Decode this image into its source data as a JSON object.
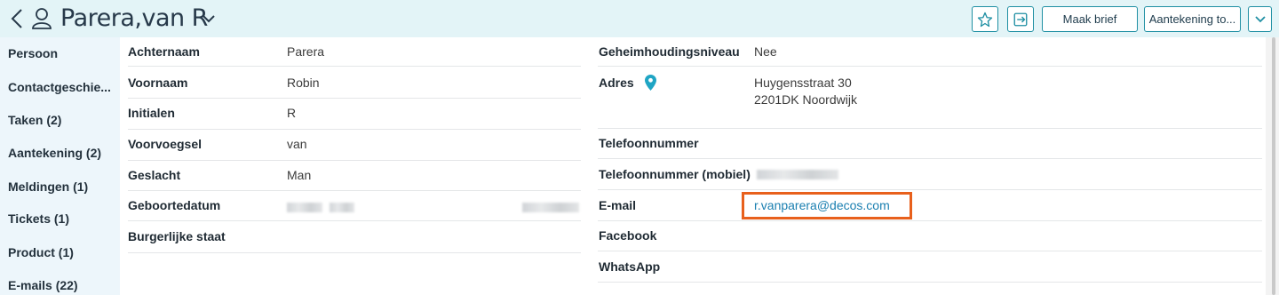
{
  "header": {
    "title": "Parera,van R",
    "buttons": {
      "brief_label": "Maak brief",
      "note_label": "Aantekening to..."
    }
  },
  "sidebar": {
    "items": [
      {
        "label": "Persoon"
      },
      {
        "label": "Contactgeschie..."
      },
      {
        "label": "Taken (2)"
      },
      {
        "label": "Aantekening (2)"
      },
      {
        "label": "Meldingen (1)"
      },
      {
        "label": "Tickets (1)"
      },
      {
        "label": "Product (1)"
      },
      {
        "label": "E-mails (22)"
      }
    ]
  },
  "left_fields": [
    {
      "label": "Achternaam",
      "value": "Parera"
    },
    {
      "label": "Voornaam",
      "value": "Robin"
    },
    {
      "label": "Initialen",
      "value": "R"
    },
    {
      "label": "Voorvoegsel",
      "value": "van"
    },
    {
      "label": "Geslacht",
      "value": "Man"
    },
    {
      "label": "Geboortedatum",
      "value": ""
    },
    {
      "label": "Burgerlijke staat",
      "value": ""
    }
  ],
  "right_fields": [
    {
      "label": "Geheimhoudingsniveau",
      "value": "Nee"
    },
    {
      "label": "Adres",
      "value": "Huygensstraat 30",
      "value2": "2201DK Noordwijk"
    },
    {
      "label": "Telefoonnummer",
      "value": ""
    },
    {
      "label": "Telefoonnummer (mobiel)",
      "value": ""
    },
    {
      "label": "E-mail",
      "value": "r.vanparera@decos.com"
    },
    {
      "label": "Facebook",
      "value": ""
    },
    {
      "label": "WhatsApp",
      "value": ""
    }
  ],
  "colors": {
    "header_bg": "#e3f4f7",
    "accent": "#1f8fa3",
    "link": "#1a7fb0",
    "highlight": "#e8601c"
  },
  "icons": {
    "back": "chevron-left-icon",
    "person": "person-icon",
    "title_dropdown": "chevron-down-icon",
    "favorite": "star-icon",
    "exit": "exit-icon",
    "more": "chevron-down-icon",
    "address": "map-pin-icon"
  }
}
